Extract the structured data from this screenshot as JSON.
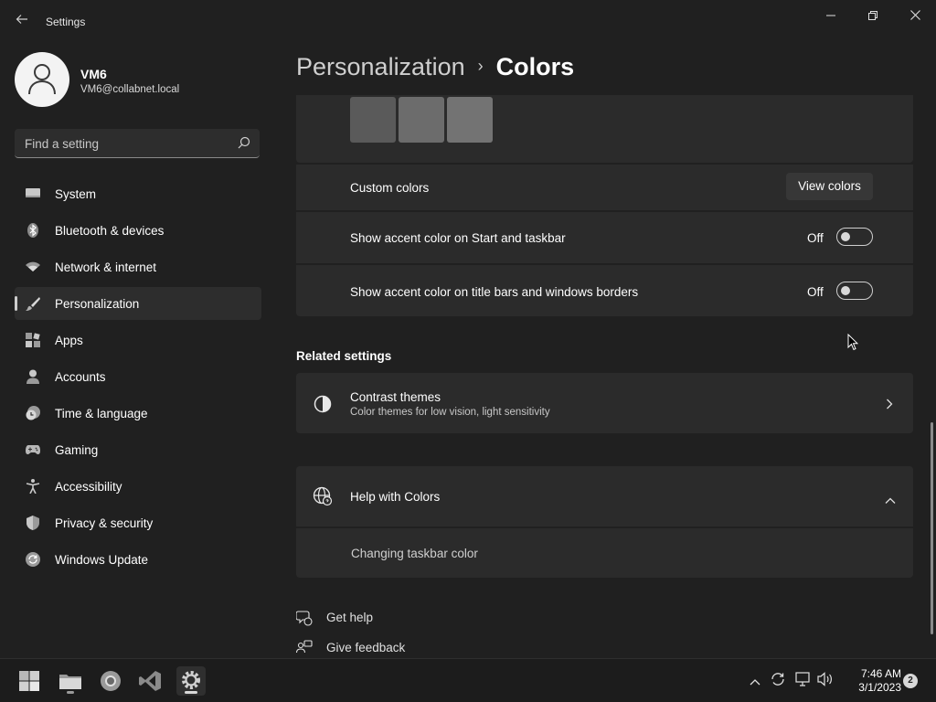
{
  "window": {
    "title": "Settings",
    "back_icon": "arrow-left-icon",
    "minimize_icon": "minimize-icon",
    "maximize_icon": "restore-icon",
    "close_icon": "close-icon"
  },
  "user": {
    "name": "VM6",
    "email": "VM6@collabnet.local"
  },
  "search": {
    "placeholder": "Find a setting"
  },
  "sidebar": {
    "items": [
      {
        "label": "System",
        "icon": "monitor-icon"
      },
      {
        "label": "Bluetooth & devices",
        "icon": "bluetooth-icon"
      },
      {
        "label": "Network & internet",
        "icon": "wifi-icon"
      },
      {
        "label": "Personalization",
        "icon": "brush-icon",
        "active": true
      },
      {
        "label": "Apps",
        "icon": "apps-icon"
      },
      {
        "label": "Accounts",
        "icon": "person-icon"
      },
      {
        "label": "Time & language",
        "icon": "clock-globe-icon"
      },
      {
        "label": "Gaming",
        "icon": "gamepad-icon"
      },
      {
        "label": "Accessibility",
        "icon": "accessibility-icon"
      },
      {
        "label": "Privacy & security",
        "icon": "shield-icon"
      },
      {
        "label": "Windows Update",
        "icon": "update-icon"
      }
    ]
  },
  "header": {
    "parent": "Personalization",
    "separator": "›",
    "current": "Colors"
  },
  "colors_card": {
    "swatches": [
      "#5a5a5a",
      "#6c6c6c",
      "#737373"
    ],
    "custom_colors_label": "Custom colors",
    "view_colors_button": "View colors",
    "accent_start_label": "Show accent color on Start and taskbar",
    "accent_start_state": "Off",
    "accent_titlebar_label": "Show accent color on title bars and windows borders",
    "accent_titlebar_state": "Off"
  },
  "related": {
    "title": "Related settings",
    "contrast_title": "Contrast themes",
    "contrast_desc": "Color themes for low vision, light sensitivity"
  },
  "help": {
    "title": "Help with Colors",
    "link": "Changing taskbar color"
  },
  "footer_links": {
    "get_help": "Get help",
    "give_feedback": "Give feedback"
  },
  "taskbar": {
    "apps": [
      "windows-start-icon",
      "file-explorer-icon",
      "chrome-icon",
      "visual-studio-icon",
      "settings-icon"
    ],
    "time": "7:46 AM",
    "date": "3/1/2023",
    "notification_count": "2"
  }
}
